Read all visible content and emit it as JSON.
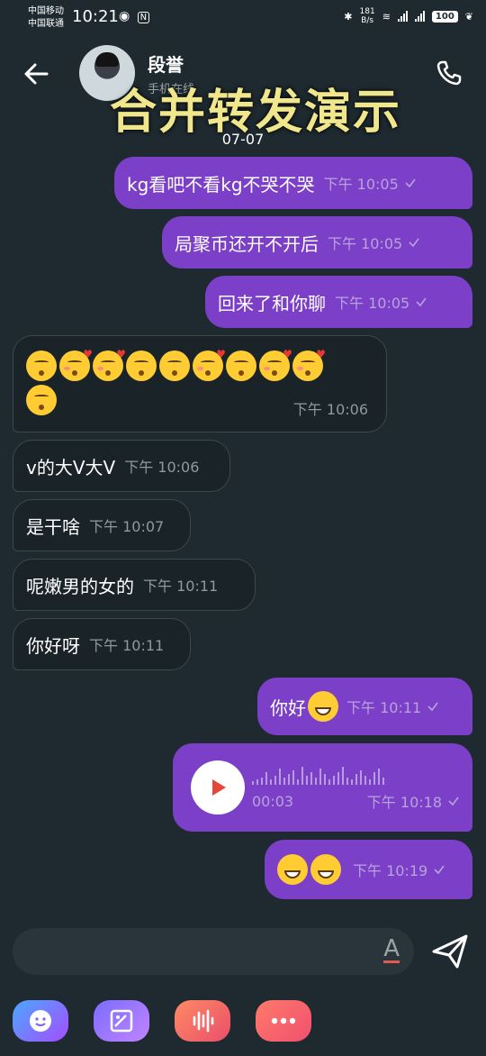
{
  "status_bar": {
    "carrier1": "中国移动",
    "carrier2": "中国联通",
    "time": "10:21",
    "speed_value": "181",
    "speed_unit": "B/s",
    "battery": "100"
  },
  "header": {
    "contact_name": "段誉",
    "contact_sub": "手机在线",
    "overlay_title": "合并转发演示"
  },
  "date_separator": "07-07",
  "messages": [
    {
      "text": "kg看吧不看kg不哭不哭",
      "time": "下午 10:05"
    },
    {
      "text": "局聚币还开不开后",
      "time": "下午 10:05"
    },
    {
      "text": "回来了和你聊",
      "time": "下午 10:05"
    },
    {
      "text": "",
      "time": "下午 10:06"
    },
    {
      "text": "v的大V大V",
      "time": "下午 10:06"
    },
    {
      "text": "是干啥",
      "time": "下午 10:07"
    },
    {
      "text": "呢嫩男的女的",
      "time": "下午 10:11"
    },
    {
      "text": "你好呀",
      "time": "下午 10:11"
    },
    {
      "text": "你好",
      "time": "下午 10:11"
    },
    {
      "text": "",
      "duration": "00:03",
      "time": "下午 10:18"
    },
    {
      "text": "",
      "time": "下午 10:19"
    }
  ],
  "input": {
    "placeholder": "",
    "font_icon_label": "A"
  },
  "toolbar": {
    "icons": [
      "emoji-icon",
      "sticker-icon",
      "voice-icon",
      "more-icon"
    ]
  },
  "colors": {
    "background": "#1e2a30",
    "outgoing_bubble": "#7b3fc8",
    "incoming_bubble": "#1a2328",
    "overlay_text": "#f0e68c"
  }
}
